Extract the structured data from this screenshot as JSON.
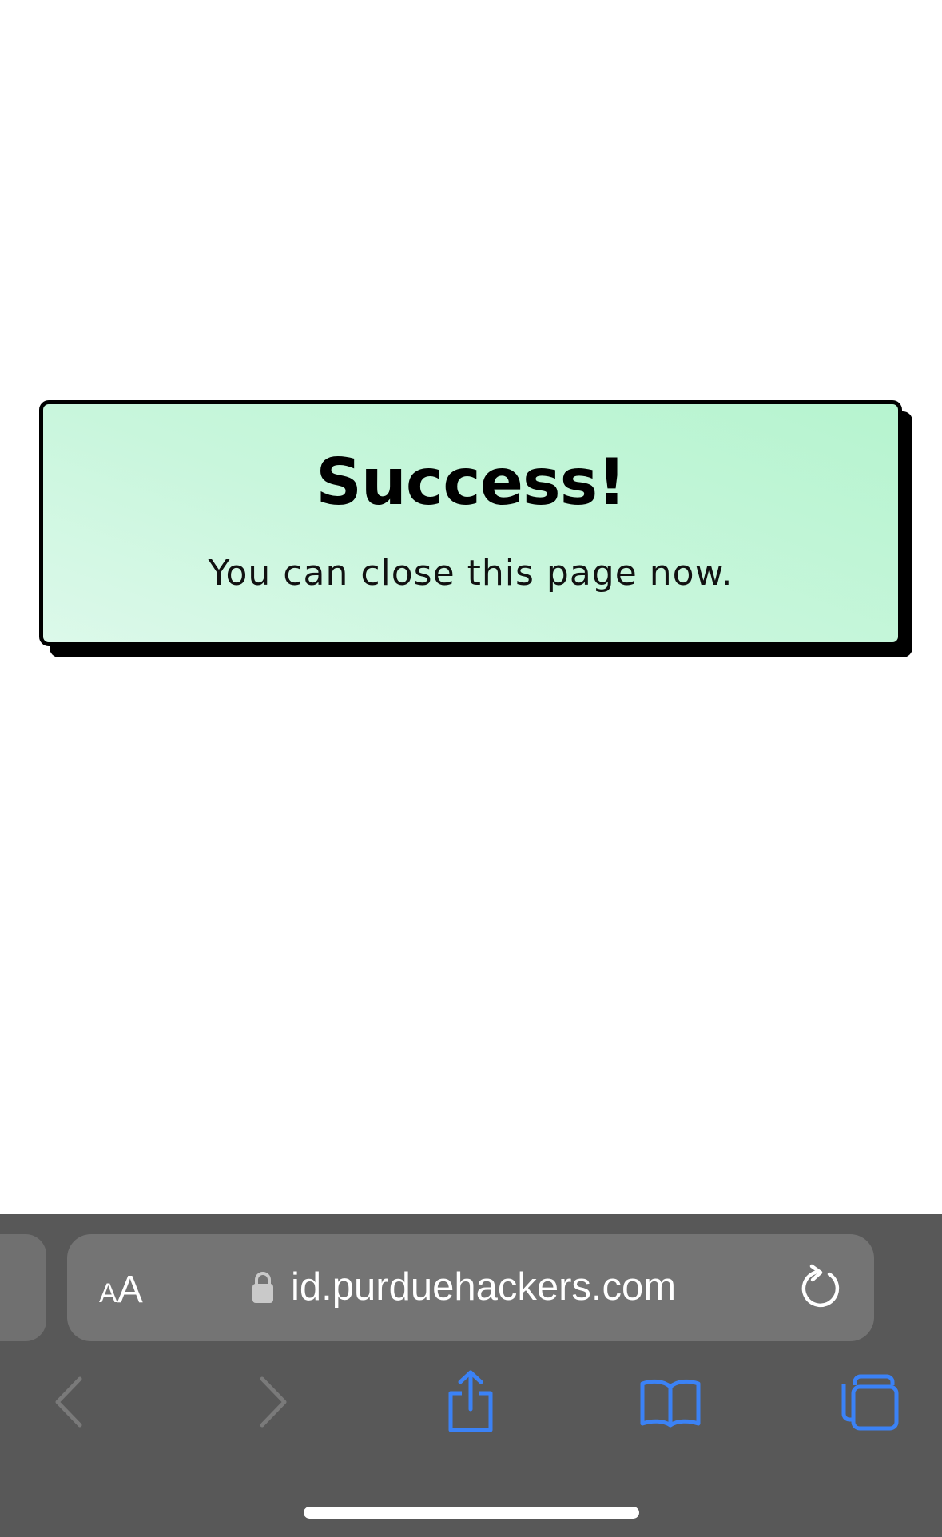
{
  "card": {
    "title": "Success!",
    "message": "You can close this page now."
  },
  "browser": {
    "text_size_button": {
      "small": "A",
      "large": "A"
    },
    "url": "id.purduehackers.com",
    "icons": {
      "lock": "lock-icon",
      "reload": "reload-icon",
      "back": "chevron-left-icon",
      "forward": "chevron-right-icon",
      "share": "share-icon",
      "bookmarks": "book-icon",
      "tabs": "tabs-icon"
    },
    "colors": {
      "accent": "#3b82f6",
      "disabled": "#7a7a7a",
      "bar_background": "#585858"
    }
  }
}
